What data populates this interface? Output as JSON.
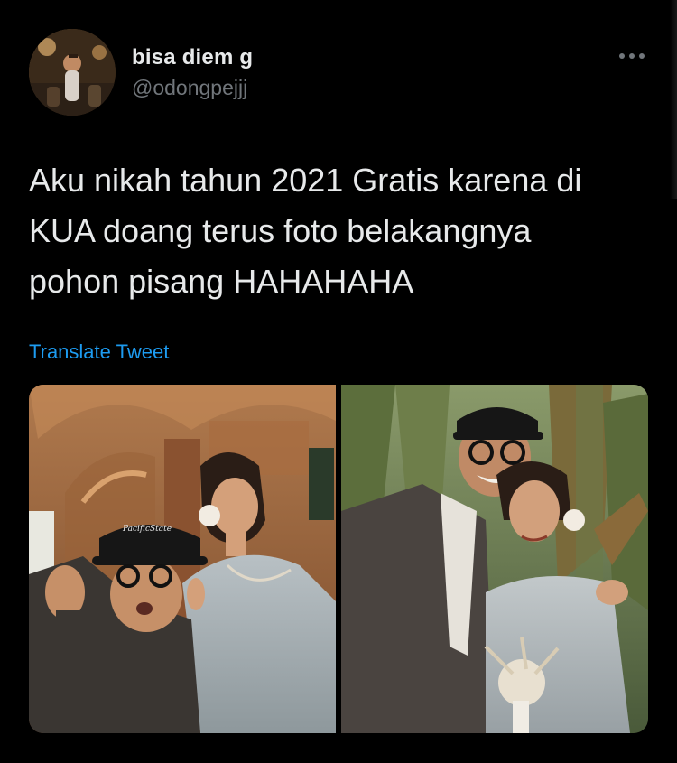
{
  "author": {
    "display_name": "bisa diem g",
    "handle": "@odongpejjj"
  },
  "icons": {
    "more": "more-horizontal-icon"
  },
  "tweet": {
    "text_lines": [
      "Aku nikah tahun 2021 Gratis karena di",
      "KUA doang terus foto belakangnya",
      "pohon pisang HAHAHAHA"
    ],
    "translate_label": "Translate Tweet"
  },
  "media": {
    "cap_text": "PacificState"
  },
  "colors": {
    "background": "#000000",
    "text_primary": "#e7e9ea",
    "text_secondary": "#71767b",
    "link": "#1d9bf0"
  }
}
